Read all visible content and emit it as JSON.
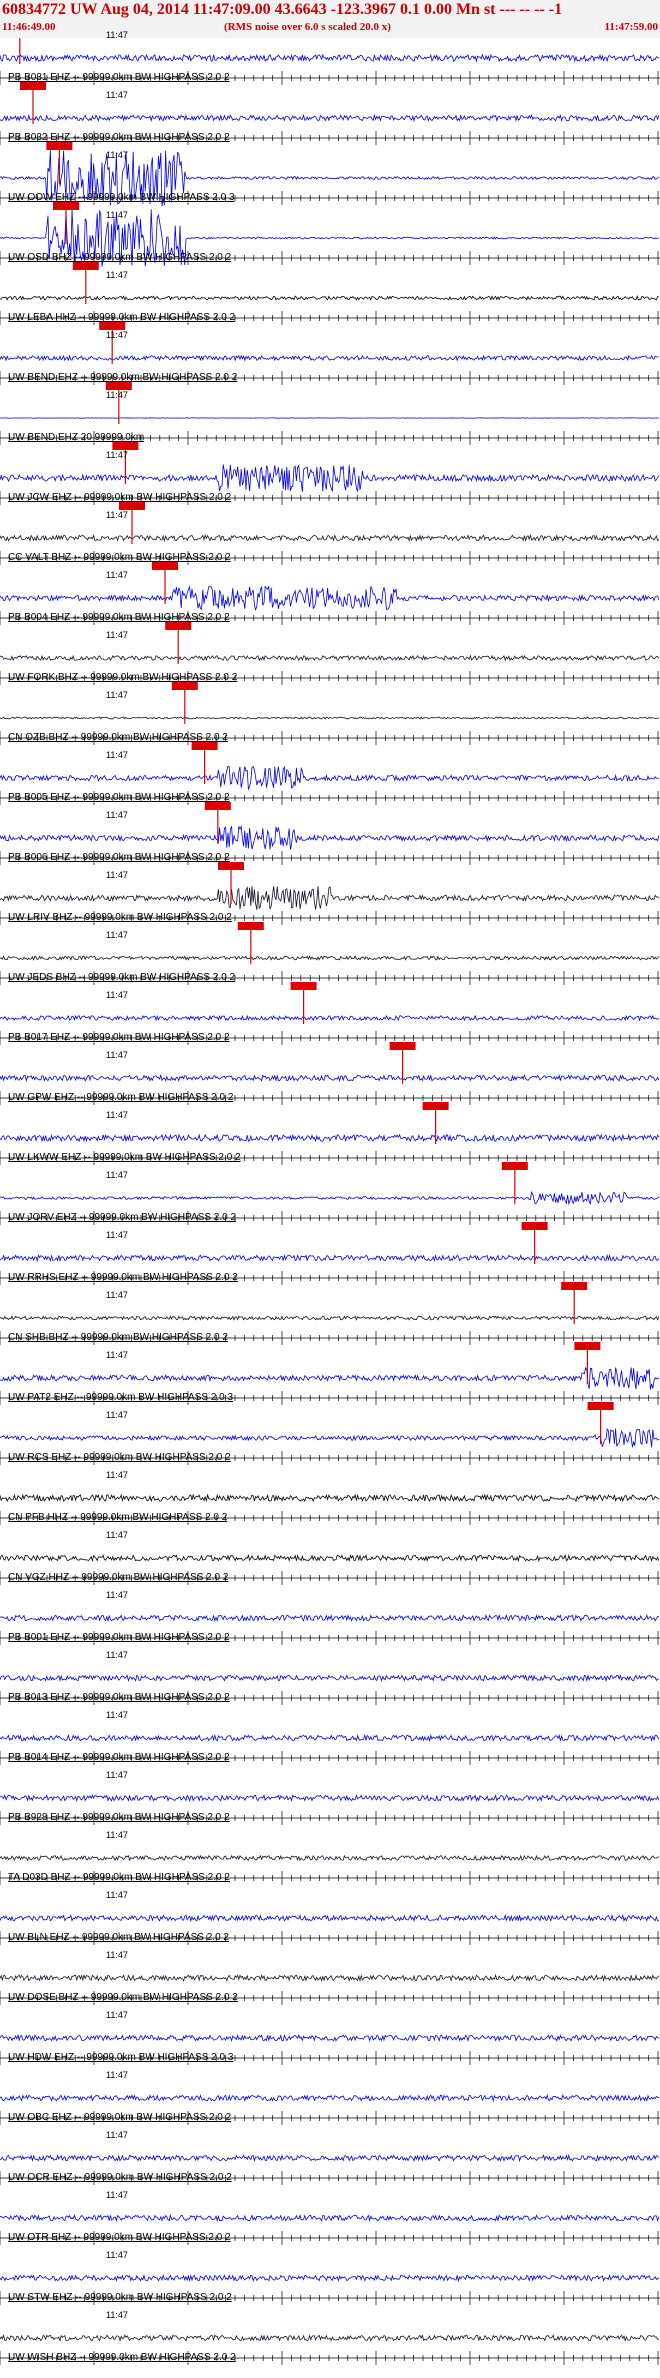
{
  "header": {
    "title": "60834772 UW Aug 04, 2014 11:47:09.00   43.6643 -123.3967  0.1 0.00 Mn st --- -- --   -1",
    "start_time": "11:46:49.00",
    "note": "(RMS noise over 6.0 s scaled 20.0 x)",
    "end_time": "11:47:59.00"
  },
  "minute_mark": "11:47",
  "colors": {
    "header_text": "#cc0000",
    "header_bg": "#f2f2f2",
    "trace_blue": "#0000ee",
    "trace_dark": "#1a1030",
    "trace_black": "#000000",
    "pick_red": "#dd0000"
  },
  "traces": [
    {
      "label": "PB B031 EHZ -- 99999.0km BW  HIGHPASS  2.0  2",
      "color": "blue",
      "pick": 0.03,
      "amp": 0.35
    },
    {
      "label": "PB B032 EHZ -- 99999.0km BW  HIGHPASS  2.0  2",
      "color": "blue",
      "pick": 0.05,
      "amp": 0.3
    },
    {
      "label": "UW OOW EHZ -- 99999.0km BW  HIGHPASS  2.0  3",
      "color": "blue",
      "pick": 0.09,
      "amp": 0.15,
      "burst": true
    },
    {
      "label": "UW OSD BHZ -- 99999.0km BW  HIGHPASS  2.0  2",
      "color": "blue",
      "pick": 0.1,
      "amp": 0.1,
      "burst": true
    },
    {
      "label": "UW LEBA HHZ -- 99999.0km BW  HIGHPASS  2.0  2",
      "color": "black",
      "pick": 0.13,
      "amp": 0.2
    },
    {
      "label": "UW BEND EHZ -- 99999.0km BW  HIGHPASS  2.0  2",
      "color": "blue",
      "pick": 0.17,
      "amp": 0.25
    },
    {
      "label": "UW BEND EHZ 20 99999.0km",
      "color": "blue",
      "pick": 0.18,
      "amp": 0.02
    },
    {
      "label": "UW JCW EHZ -- 99999.0km BW  HIGHPASS  2.0  2",
      "color": "blue",
      "pick": 0.19,
      "amp": 0.35,
      "event": [
        0.33,
        0.55
      ]
    },
    {
      "label": "CC VALT BHZ -- 99999.0km BW  HIGHPASS  2.0  2",
      "color": "dark",
      "pick": 0.2,
      "amp": 0.3
    },
    {
      "label": "PB B004 EHZ -- 99999.0km BW  HIGHPASS  2.0  2",
      "color": "blue",
      "pick": 0.25,
      "amp": 0.3,
      "event": [
        0.26,
        0.6
      ]
    },
    {
      "label": "UW FORK BHZ -- 99999.0km BW  HIGHPASS  2.0  2",
      "color": "dark",
      "pick": 0.27,
      "amp": 0.25
    },
    {
      "label": "CN OZB BHZ -- 99999.0km BW  HIGHPASS  2.0  2",
      "color": "dark",
      "pick": 0.28,
      "amp": 0.1
    },
    {
      "label": "PB B005 EHZ -- 99999.0km BW  HIGHPASS  2.0  2",
      "color": "blue",
      "pick": 0.31,
      "amp": 0.3,
      "event": [
        0.33,
        0.46
      ]
    },
    {
      "label": "PB B006 EHZ -- 99999.0km BW  HIGHPASS  2.0  2",
      "color": "blue",
      "pick": 0.33,
      "amp": 0.3,
      "event": [
        0.33,
        0.45
      ]
    },
    {
      "label": "UW LRIV BHZ -- 99999.0km BW  HIGHPASS  2.0  2",
      "color": "dark",
      "pick": 0.35,
      "amp": 0.3,
      "event": [
        0.33,
        0.5
      ]
    },
    {
      "label": "UW JEDS BHZ -- 99999.0km BW  HIGHPASS  2.0  2",
      "color": "dark",
      "pick": 0.38,
      "amp": 0.2
    },
    {
      "label": "PB B017 EHZ -- 99999.0km BW  HIGHPASS  2.0  2",
      "color": "blue",
      "pick": 0.46,
      "amp": 0.25
    },
    {
      "label": "UW GPW EHZ -- 99999.0km BW  HIGHPASS  2.0  2",
      "color": "blue",
      "pick": 0.61,
      "amp": 0.3
    },
    {
      "label": "UW LKWW EHZ -- 99999.0km BW  HIGHPASS  2.0  2",
      "color": "blue",
      "pick": 0.66,
      "amp": 0.35
    },
    {
      "label": "UW JORV EHZ -- 99999.0km BW  HIGHPASS  2.0  2",
      "color": "blue",
      "pick": 0.78,
      "amp": 0.15,
      "event": [
        0.8,
        0.95
      ]
    },
    {
      "label": "UW RRHS EHZ -- 99999.0km BW  HIGHPASS  2.0  2",
      "color": "blue",
      "pick": 0.81,
      "amp": 0.3
    },
    {
      "label": "CN SHB BHZ -- 99999.0km BW  HIGHPASS  2.0  2",
      "color": "dark",
      "pick": 0.87,
      "amp": 0.2
    },
    {
      "label": "UW PAT2 EHZ -- 99999.0km BW  HIGHPASS  2.0  3",
      "color": "blue",
      "pick": 0.89,
      "amp": 0.3,
      "event": [
        0.88,
        0.99
      ]
    },
    {
      "label": "UW RCS EHZ -- 99999.0km BW  HIGHPASS  2.0  2",
      "color": "blue",
      "pick": 0.91,
      "amp": 0.25,
      "event": [
        0.9,
        0.99
      ]
    },
    {
      "label": "CN PFB HHZ -- 99999.0km BW  HIGHPASS  2.0  2",
      "color": "black",
      "amp": 0.35
    },
    {
      "label": "CN VGZ HHZ -- 99999.0km BW  HIGHPASS  2.0  2",
      "color": "black",
      "amp": 0.3
    },
    {
      "label": "PB B001 EHZ -- 99999.0km BW  HIGHPASS  2.0  2",
      "color": "blue",
      "amp": 0.3
    },
    {
      "label": "PB B013 EHZ -- 99999.0km BW  HIGHPASS  2.0  2",
      "color": "blue",
      "amp": 0.3
    },
    {
      "label": "PB B014 EHZ -- 99999.0km BW  HIGHPASS  2.0  2",
      "color": "blue",
      "amp": 0.3
    },
    {
      "label": "PB B928 EHZ -- 99999.0km BW  HIGHPASS  2.0  2",
      "color": "blue",
      "amp": 0.3
    },
    {
      "label": "TA D03D BHZ -- 99999.0km BW  HIGHPASS  2.0  2",
      "color": "dark",
      "amp": 0.25
    },
    {
      "label": "UW BLN EHZ -- 99999.0km BW  HIGHPASS  2.0  2",
      "color": "blue",
      "amp": 0.3
    },
    {
      "label": "UW DOSE BHZ -- 99999.0km BW  HIGHPASS  2.0  2",
      "color": "dark",
      "amp": 0.3
    },
    {
      "label": "UW HDW EHZ -- 99999.0km BW  HIGHPASS  2.0  3",
      "color": "blue",
      "amp": 0.3
    },
    {
      "label": "UW OBC EHZ -- 99999.0km BW  HIGHPASS  2.0  2",
      "color": "blue",
      "amp": 0.3
    },
    {
      "label": "UW OCR EHZ -- 99999.0km BW  HIGHPASS  2.0  2",
      "color": "blue",
      "amp": 0.3
    },
    {
      "label": "UW OTR EHZ -- 99999.0km BW  HIGHPASS  2.0  2",
      "color": "blue",
      "amp": 0.3
    },
    {
      "label": "UW STW EHZ -- 99999.0km BW  HIGHPASS  2.0  2",
      "color": "blue",
      "amp": 0.3
    },
    {
      "label": "UW WISH BHZ -- 99999.0km BW  HIGHPASS  2.0  2",
      "color": "dark",
      "amp": 0.3
    }
  ]
}
